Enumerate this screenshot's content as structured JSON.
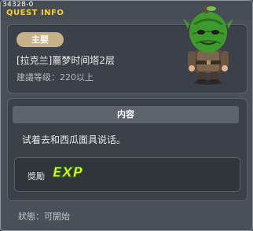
{
  "window": {
    "quest_id": "34328-0",
    "title": "QUEST INFO"
  },
  "header": {
    "tag": "主要",
    "quest_name": "[拉克兰]噩梦时间塔2层",
    "level_requirement": "建議等级：220以上"
  },
  "content": {
    "section_title": "内容",
    "text": "试着去和西瓜面具说话。"
  },
  "reward": {
    "label": "獎勵",
    "exp_label": "EXP"
  },
  "footer": {
    "status": "狀態：可開始"
  },
  "colors": {
    "title": "#f7cf3a",
    "tag_bg": "#c8b188",
    "exp_fill": "#f3f026",
    "exp_outline": "#2f7d10"
  },
  "npc_icon": "watermelon-mask-npc-icon"
}
